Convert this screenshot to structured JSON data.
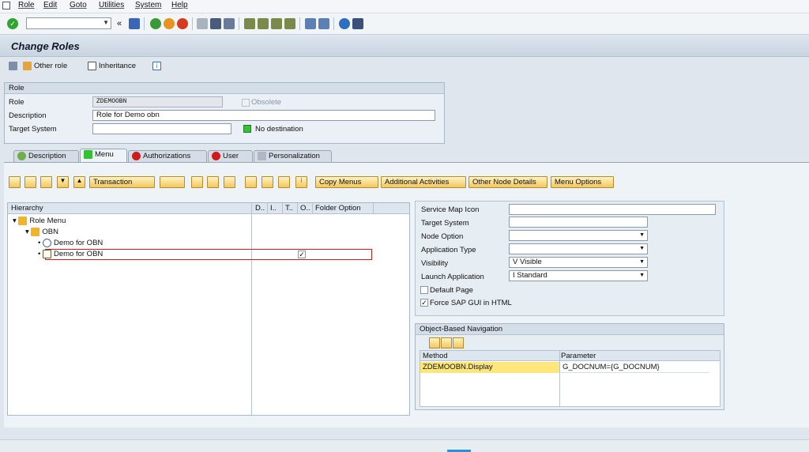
{
  "menubar": {
    "items": [
      "Role",
      "Edit",
      "Goto",
      "Utilities",
      "System",
      "Help"
    ]
  },
  "toolbar": {
    "command_value": "",
    "back_glyph": "«"
  },
  "page": {
    "title": "Change Roles"
  },
  "app_toolbar": {
    "other_role": "Other role",
    "inheritance": "Inheritance"
  },
  "role_group": {
    "header": "Role",
    "role_label": "Role",
    "role_value": "ZDEMOOBN",
    "obsolete_label": "Obsolete",
    "description_label": "Description",
    "description_value": "Role for Demo obn",
    "target_system_label": "Target System",
    "target_system_value": "",
    "destination_status": "No destination"
  },
  "tabs": [
    "Description",
    "Menu",
    "Authorizations",
    "User",
    "Personalization"
  ],
  "menu_toolbar": {
    "transaction": "Transaction",
    "copy_menus": "Copy Menus",
    "additional_activities": "Additional Activities",
    "other_node_details": "Other Node Details",
    "menu_options": "Menu Options"
  },
  "tree": {
    "columns": [
      "Hierarchy",
      "D..",
      "I..",
      "T..",
      "O..",
      "Folder Option"
    ],
    "nodes": [
      "Role Menu",
      "OBN",
      "Demo for OBN",
      "Demo for OBN"
    ],
    "checkmark": "✓"
  },
  "details": {
    "service_map_icon_label": "Service Map Icon",
    "service_map_icon_value": "",
    "target_system_label": "Target System",
    "target_system_value": "",
    "node_option_label": "Node Option",
    "node_option_value": "",
    "application_type_label": "Application Type",
    "application_type_value": "",
    "visibility_label": "Visibility",
    "visibility_value": "V Visible",
    "launch_application_label": "Launch Application",
    "launch_application_value": "I Standard",
    "default_page_label": "Default Page",
    "force_sapgui_label": "Force SAP GUI in HTML"
  },
  "obn": {
    "header": "Object-Based Navigation",
    "col_method": "Method",
    "col_parameter": "Parameter",
    "row_method": "ZDEMOOBN.Display",
    "row_parameter": "G_DOCNUM={G_DOCNUM}"
  },
  "colors": {
    "accent_yellow": "#f3c760",
    "selection_yellow": "#fde67a",
    "status_green": "#35c035",
    "status_red": "#d11a1a"
  }
}
